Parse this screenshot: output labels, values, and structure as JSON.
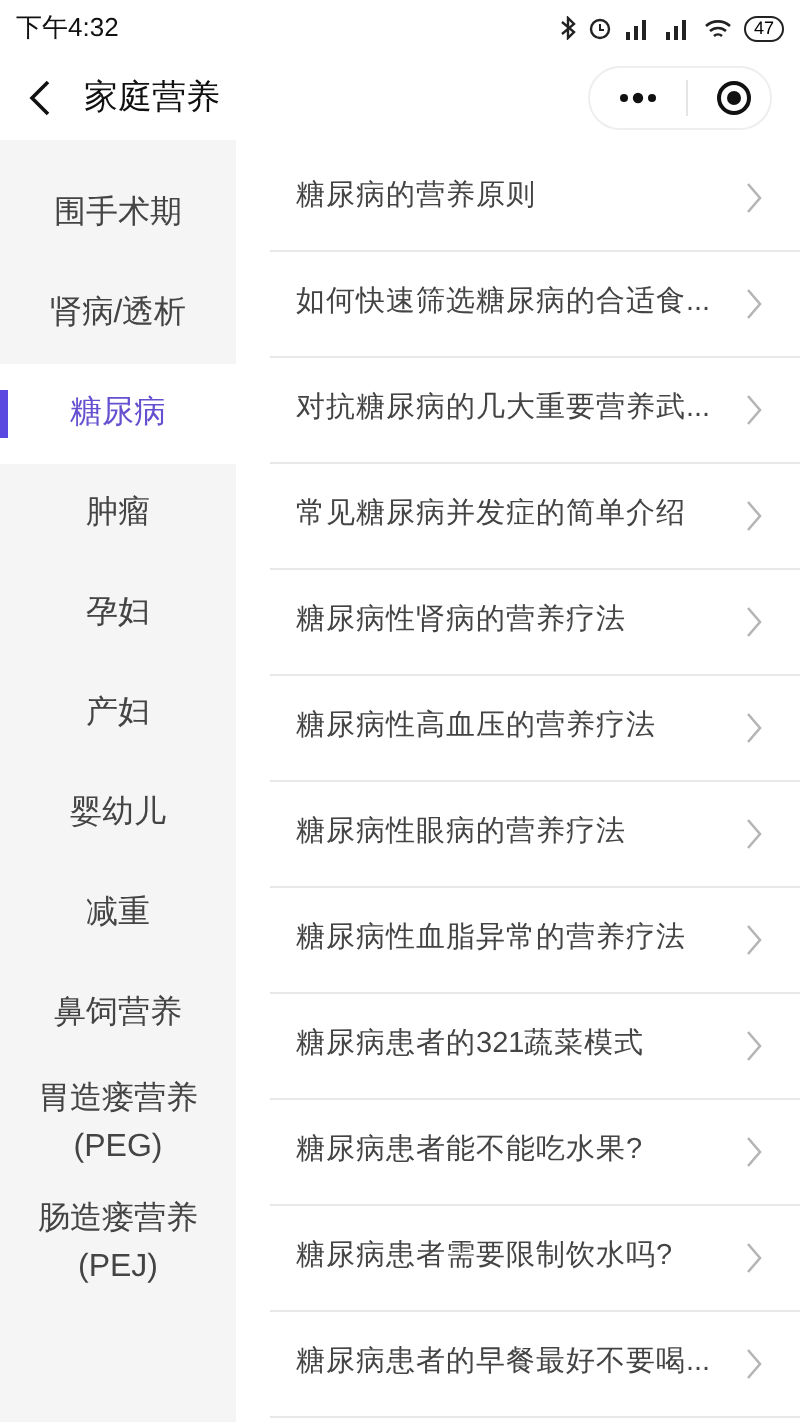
{
  "status_bar": {
    "time": "下午4:32",
    "battery": "47"
  },
  "nav": {
    "title": "家庭营养"
  },
  "sidebar": {
    "items": [
      {
        "label": "围手术期",
        "selected": false
      },
      {
        "label": "肾病/透析",
        "selected": false
      },
      {
        "label": "糖尿病",
        "selected": true
      },
      {
        "label": "肿瘤",
        "selected": false
      },
      {
        "label": "孕妇",
        "selected": false
      },
      {
        "label": "产妇",
        "selected": false
      },
      {
        "label": "婴幼儿",
        "selected": false
      },
      {
        "label": "减重",
        "selected": false
      },
      {
        "label": "鼻饲营养",
        "selected": false
      },
      {
        "label": "胃造瘘营养 (PEG)",
        "selected": false
      },
      {
        "label": "肠造瘘营养 (PEJ)",
        "selected": false
      }
    ]
  },
  "articles": [
    "糖尿病的营养原则",
    "如何快速筛选糖尿病的合适食...",
    "对抗糖尿病的几大重要营养武...",
    "常见糖尿病并发症的简单介绍",
    "糖尿病性肾病的营养疗法",
    "糖尿病性高血压的营养疗法",
    "糖尿病性眼病的营养疗法",
    "糖尿病性血脂异常的营养疗法",
    "糖尿病患者的321蔬菜模式",
    "糖尿病患者能不能吃水果?",
    "糖尿病患者需要限制饮水吗?",
    "糖尿病患者的早餐最好不要喝..."
  ]
}
